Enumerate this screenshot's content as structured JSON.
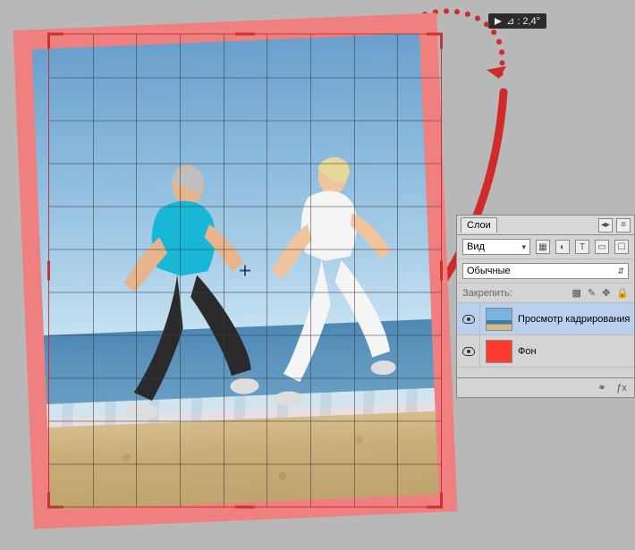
{
  "rotation": {
    "angle_label": "⊿ : 2,4°"
  },
  "panel": {
    "tab_label": "Слои",
    "type_dropdown": "Вид",
    "blend_mode": "Обычные",
    "lock_label": "Закрепить:",
    "layers": [
      {
        "name": "Просмотр кадрирования",
        "selected": true,
        "thumb": "scene"
      },
      {
        "name": "Фон",
        "selected": false,
        "thumb": "red"
      }
    ]
  },
  "crop": {
    "cols": 9,
    "rows": 11
  }
}
